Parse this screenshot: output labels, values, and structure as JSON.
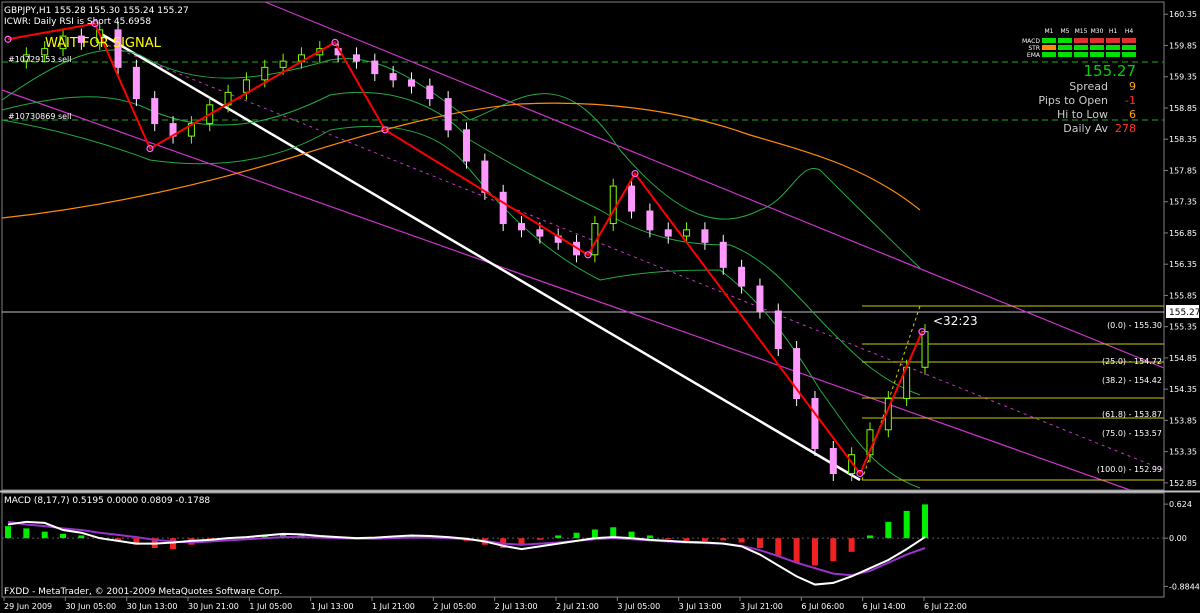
{
  "header": {
    "symbol_line": "GBPJPY,H1  155.28 155.30 155.24 155.27",
    "indicator_line": "ICWR: Daily RSI is Short 45.6958",
    "signal_text": "WAIT FOR SIGNAL",
    "level_label_1": "#10729153 sell",
    "level_label_2": "#10730869 sell",
    "countdown": "<32:23"
  },
  "status_panel": {
    "timeframes": [
      "M1",
      "M5",
      "M15",
      "M30",
      "H1",
      "H4"
    ],
    "rows": [
      {
        "label": "MACD",
        "colors": [
          "#00e000",
          "#00e000",
          "#e03030",
          "#e03030",
          "#e03030",
          "#e03030"
        ]
      },
      {
        "label": "STR",
        "colors": [
          "#ff8c00",
          "#00e000",
          "#00e000",
          "#00e000",
          "#00e000",
          "#00e000"
        ]
      },
      {
        "label": "EMA",
        "colors": [
          "#00e000",
          "#00e000",
          "#00e000",
          "#00e000",
          "#00e000",
          "#00e000"
        ]
      }
    ],
    "price": "155.27",
    "stats": [
      {
        "label": "Spread",
        "value": "9",
        "color": "#ffa500"
      },
      {
        "label": "Pips to Open",
        "value": "-1",
        "color": "#ff3030"
      },
      {
        "label": "Hi to Low",
        "value": "6",
        "color": "#ffa500"
      },
      {
        "label": "Daily Av",
        "value": "278",
        "color": "#ff3030"
      }
    ]
  },
  "footer": {
    "macd_label": "MACD (8,17,7) 0.5195 0.0000 0.0809 -0.1788",
    "copyright": "FXDD - MetaTrader, © 2001-2009 MetaQuotes Software Corp."
  },
  "chart_data": {
    "type": "line",
    "title": "GBPJPY,H1",
    "price_axis_ticks": [
      "160.35",
      "159.85",
      "159.35",
      "158.85",
      "158.35",
      "157.85",
      "157.35",
      "156.85",
      "156.35",
      "155.85",
      "155.35",
      "154.85",
      "154.35",
      "153.85",
      "153.35",
      "152.85"
    ],
    "ylim": [
      152.8,
      160.45
    ],
    "current_price": "155.27",
    "x_axis_ticks": [
      "29 Jun 2009",
      "30 Jun 05:00",
      "30 Jun 13:00",
      "30 Jun 21:00",
      "1 Jul 05:00",
      "1 Jul 13:00",
      "1 Jul 21:00",
      "2 Jul 05:00",
      "2 Jul 13:00",
      "2 Jul 21:00",
      "3 Jul 05:00",
      "3 Jul 13:00",
      "3 Jul 21:00",
      "6 Jul 06:00",
      "6 Jul 14:00",
      "6 Jul 22:00"
    ],
    "fibonacci_levels": [
      {
        "label": "(0.0) - 155.30",
        "price": 155.3
      },
      {
        "label": "(25.0) - 154.72",
        "price": 154.72
      },
      {
        "label": "(38.2) - 154.42",
        "price": 154.42
      },
      {
        "label": "(61.8) - 153.87",
        "price": 153.87
      },
      {
        "label": "(75.0) - 153.57",
        "price": 153.57
      },
      {
        "label": "(100.0) - 152.99",
        "price": 152.99
      }
    ],
    "zigzag": [
      159.95,
      160.2,
      158.2,
      159.9,
      158.5,
      156.5,
      157.8,
      153.0,
      155.27
    ],
    "close_series": [
      159.6,
      159.7,
      159.8,
      160.0,
      159.9,
      160.1,
      159.5,
      159.0,
      158.6,
      158.4,
      158.6,
      158.9,
      159.1,
      159.3,
      159.5,
      159.6,
      159.7,
      159.8,
      159.7,
      159.6,
      159.4,
      159.3,
      159.2,
      159.0,
      158.5,
      158.0,
      157.5,
      157.0,
      156.9,
      156.8,
      156.7,
      156.5,
      157.0,
      157.6,
      157.2,
      156.9,
      156.8,
      156.9,
      156.7,
      156.3,
      156.0,
      155.6,
      155.0,
      154.2,
      153.4,
      153.0,
      153.3,
      153.7,
      154.2,
      154.7,
      155.27
    ],
    "macd_axis": {
      "ticks": [
        "0.624",
        "0.00",
        "-0.8844"
      ],
      "ylim": [
        -0.95,
        0.7
      ]
    },
    "macd_histogram": [
      0.22,
      0.18,
      0.12,
      0.08,
      0.05,
      0.02,
      -0.05,
      -0.12,
      -0.18,
      -0.2,
      -0.12,
      -0.05,
      0.0,
      0.03,
      0.06,
      0.08,
      0.05,
      0.02,
      0.0,
      -0.02,
      -0.01,
      0.02,
      0.04,
      0.03,
      0.0,
      -0.05,
      -0.12,
      -0.18,
      -0.12,
      -0.03,
      0.05,
      0.1,
      0.16,
      0.2,
      0.12,
      0.05,
      -0.02,
      -0.06,
      -0.05,
      -0.04,
      -0.08,
      -0.18,
      -0.32,
      -0.45,
      -0.5,
      -0.42,
      -0.25,
      0.05,
      0.3,
      0.5,
      0.62
    ],
    "macd_signal": [
      0.3,
      0.25,
      0.22,
      0.18,
      0.15,
      0.1,
      0.06,
      0.02,
      -0.03,
      -0.06,
      -0.08,
      -0.06,
      -0.04,
      -0.02,
      0.0,
      0.02,
      0.02,
      0.01,
      0.0,
      -0.01,
      -0.01,
      0.0,
      0.01,
      0.01,
      0.0,
      -0.02,
      -0.05,
      -0.1,
      -0.12,
      -0.1,
      -0.08,
      -0.05,
      -0.02,
      0.0,
      -0.02,
      -0.04,
      -0.06,
      -0.08,
      -0.09,
      -0.1,
      -0.14,
      -0.22,
      -0.33,
      -0.45,
      -0.55,
      -0.65,
      -0.68,
      -0.6,
      -0.45,
      -0.3,
      -0.18
    ],
    "macd_line": [
      0.25,
      0.3,
      0.28,
      0.15,
      0.1,
      0.0,
      -0.05,
      -0.1,
      -0.1,
      -0.08,
      -0.05,
      -0.03,
      0.0,
      0.02,
      0.05,
      0.08,
      0.07,
      0.04,
      0.02,
      0.0,
      0.01,
      0.03,
      0.05,
      0.04,
      0.02,
      -0.01,
      -0.06,
      -0.14,
      -0.2,
      -0.15,
      -0.1,
      -0.05,
      0.0,
      0.02,
      0.0,
      -0.03,
      -0.05,
      -0.07,
      -0.08,
      -0.1,
      -0.15,
      -0.3,
      -0.5,
      -0.7,
      -0.85,
      -0.82,
      -0.7,
      -0.55,
      -0.4,
      -0.2,
      0.02
    ]
  },
  "colors": {
    "up_candle": "#7fff00",
    "down_candle": "#ffffff",
    "bear_body": "#ff99ff",
    "zigzag": "#ff0000",
    "channel": "#cc33cc",
    "bands": "#22aa44",
    "slow_ma": "#ff8c00",
    "fib": "#cccc00",
    "hist_up": "#00ee00",
    "hist_down": "#ee2222",
    "signal_text": "#ffff00"
  }
}
